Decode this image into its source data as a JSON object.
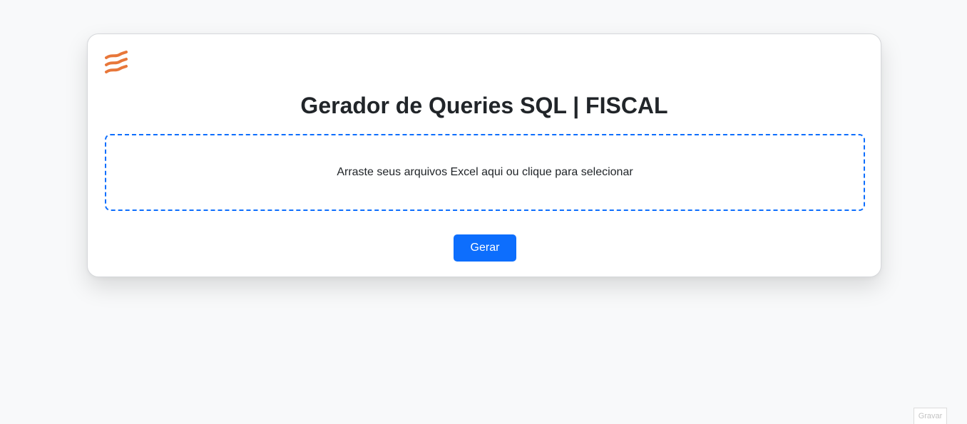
{
  "app": {
    "title": "Gerador de Queries SQL | FISCAL",
    "logo_icon": "wave-lines-icon",
    "logo_color": "#e8773a"
  },
  "dropzone": {
    "text": "Arraste seus arquivos Excel aqui ou clique para selecionar",
    "border_color": "#0d6efd"
  },
  "actions": {
    "generate_label": "Gerar",
    "generate_color": "#0d6efd"
  },
  "recorder": {
    "record_label": "Gravar"
  }
}
